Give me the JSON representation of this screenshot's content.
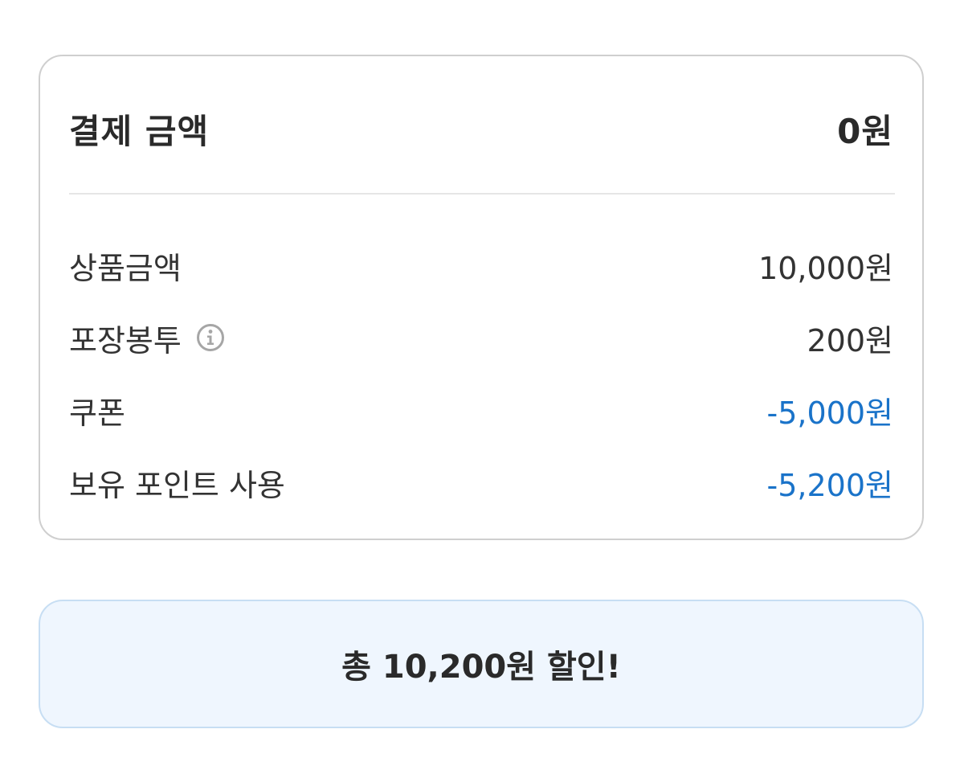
{
  "payment": {
    "title": "결제 금액",
    "total": "0원",
    "items": [
      {
        "label": "상품금액",
        "value": "10,000원"
      },
      {
        "label": "포장봉투",
        "value": "200원"
      },
      {
        "label": "쿠폰",
        "value": "-5,000원"
      },
      {
        "label": "보유 포인트 사용",
        "value": "-5,200원"
      }
    ]
  },
  "summary": {
    "text": "총 10,200원 할인!"
  },
  "icons": {
    "packaging_info": "info-icon"
  },
  "colors": {
    "discount": "#1a73c9",
    "summary_background": "#eff6fe",
    "summary_border": "#c7def3"
  }
}
